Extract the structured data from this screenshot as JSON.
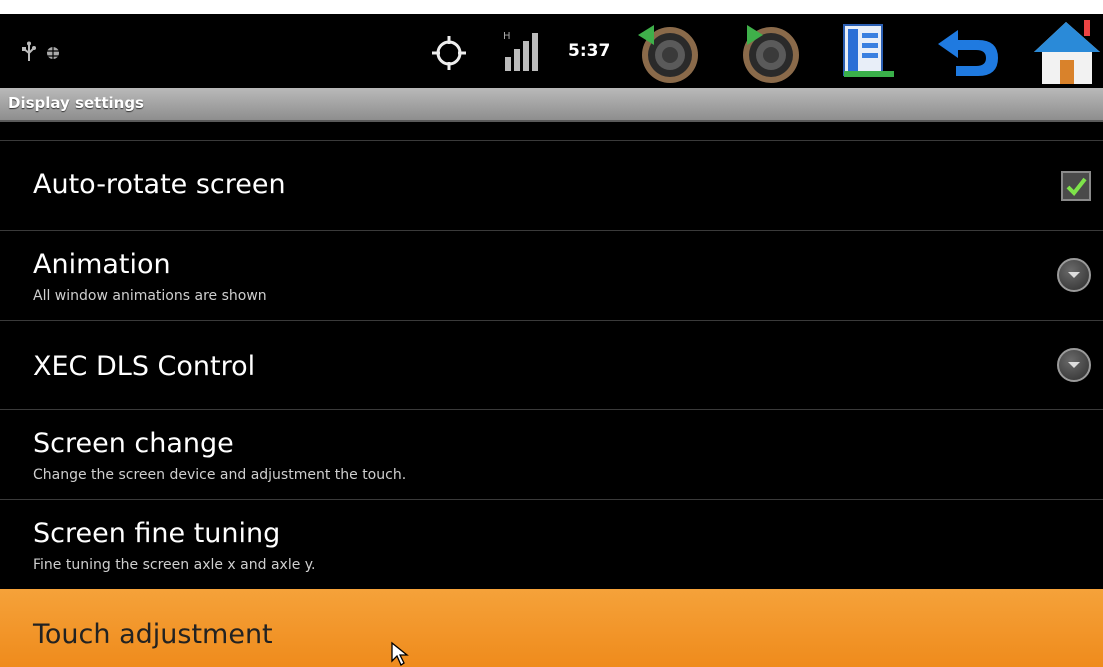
{
  "status_bar": {
    "time": "5:37",
    "icons": [
      "usb-icon",
      "debug-icon",
      "gps-icon",
      "signal-icon",
      "volume-down-icon",
      "volume-up-icon",
      "menu-icon",
      "back-icon",
      "home-icon"
    ]
  },
  "title_bar": {
    "title": "Display settings"
  },
  "settings": [
    {
      "title": "Auto-rotate screen",
      "checked": true
    },
    {
      "title": "Animation",
      "subtitle": "All window animations are shown"
    },
    {
      "title": "XEC DLS Control"
    },
    {
      "title": "Screen change",
      "subtitle": "Change the screen device and adjustment the touch."
    },
    {
      "title": "Screen fine tuning",
      "subtitle": "Fine tuning the screen axle x and axle y."
    },
    {
      "title": "Touch adjustment"
    }
  ],
  "colors": {
    "highlight": "#ef8b1c",
    "check": "#7ee34a",
    "background": "#000000"
  }
}
